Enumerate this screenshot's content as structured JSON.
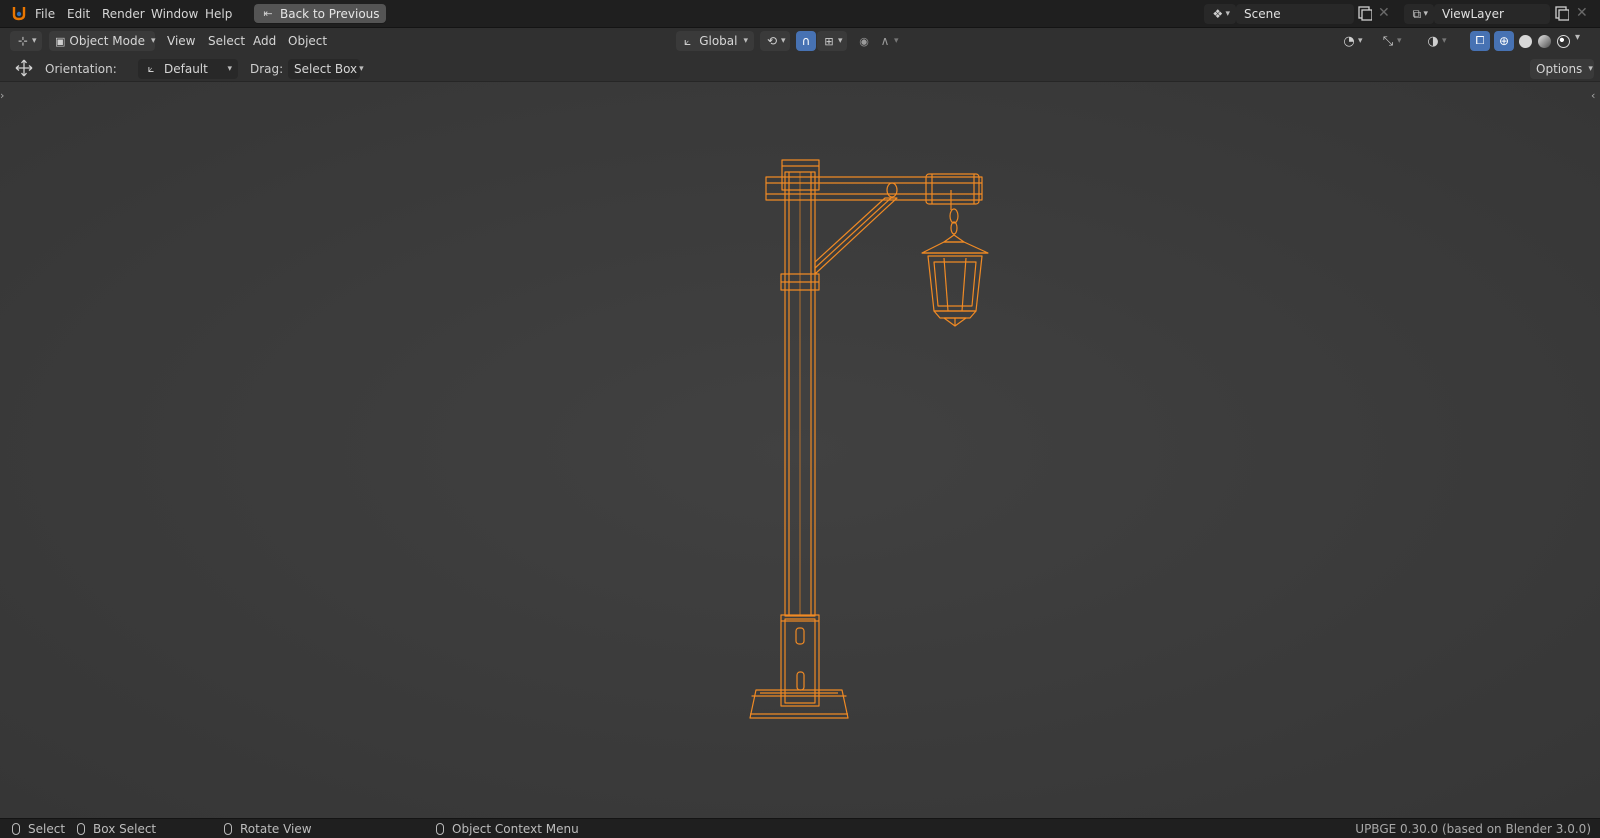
{
  "topbar": {
    "menus": [
      "File",
      "Edit",
      "Render",
      "Window",
      "Help"
    ],
    "back_button": "Back to Previous",
    "scene_name": "Scene",
    "view_layer_name": "ViewLayer"
  },
  "header": {
    "mode": "Object Mode",
    "menus": [
      "View",
      "Select",
      "Add",
      "Object"
    ],
    "transform_orientation": "Global"
  },
  "tool_settings": {
    "orientation_label": "Orientation:",
    "orientation_value": "Default",
    "drag_label": "Drag:",
    "drag_value": "Select Box",
    "options_label": "Options"
  },
  "viewport": {
    "object": "street-lamp",
    "selection_color": "#f08a24",
    "background_color": "#3c3c3c"
  },
  "statusbar": {
    "hints": [
      "Select",
      "Box Select",
      "Rotate View",
      "Object Context Menu"
    ],
    "version": "UPBGE 0.30.0 (based on Blender 3.0.0)"
  }
}
